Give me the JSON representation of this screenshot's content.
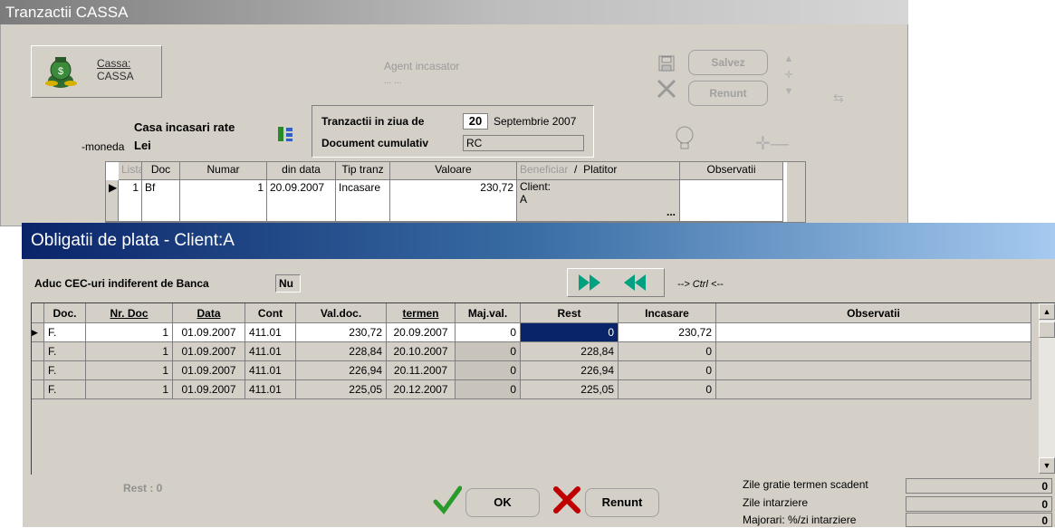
{
  "bg_window": {
    "title": "Tranzactii CASSA",
    "cassa_label": "Cassa:",
    "cassa_value": "CASSA",
    "agent_label": "Agent incasator",
    "agent_value": "... ...",
    "save_label": "Salvez",
    "cancel_label": "Renunt",
    "casa_label": "Casa incasari rate",
    "moneda_label": "-moneda",
    "moneda_value": "Lei",
    "tranzactii_label": "Tranzactii in ziua de",
    "day": "20",
    "month_year": "Septembrie 2007",
    "doc_label": "Document cumulativ",
    "doc_value": "RC",
    "columns": [
      "Lista",
      "Doc",
      "Numar",
      "din data",
      "Tip tranz",
      "Valoare",
      "Beneficiar",
      "/",
      "Platitor",
      "Observatii"
    ],
    "row": {
      "lista": "1",
      "doc": "Bf",
      "numar": "1",
      "din_data": "20.09.2007",
      "tip": "Incasare",
      "valoare": "230,72",
      "beneficiar_line1": "Client:",
      "beneficiar_line2": "A",
      "ellipsis": "..."
    }
  },
  "dialog": {
    "title": "Obligatii de plata - Client:A",
    "aduc_label": "Aduc CEC-uri indiferent de Banca",
    "aduc_value": "Nu",
    "ctrl_hint": "--> Ctrl <--",
    "columns": [
      "Doc.",
      "Nr. Doc",
      "Data",
      "Cont",
      "Val.doc.",
      "termen",
      "Maj.val.",
      "Rest",
      "Incasare",
      "Observatii"
    ],
    "rows": [
      {
        "doc": "F.",
        "nr": "1",
        "data": "01.09.2007",
        "cont": "411.01",
        "val": "230,72",
        "termen": "20.09.2007",
        "maj": "0",
        "rest": "0",
        "incasare": "230,72",
        "obs": ""
      },
      {
        "doc": "F.",
        "nr": "1",
        "data": "01.09.2007",
        "cont": "411.01",
        "val": "228,84",
        "termen": "20.10.2007",
        "maj": "0",
        "rest": "228,84",
        "incasare": "0",
        "obs": ""
      },
      {
        "doc": "F.",
        "nr": "1",
        "data": "01.09.2007",
        "cont": "411.01",
        "val": "226,94",
        "termen": "20.11.2007",
        "maj": "0",
        "rest": "226,94",
        "incasare": "0",
        "obs": ""
      },
      {
        "doc": "F.",
        "nr": "1",
        "data": "01.09.2007",
        "cont": "411.01",
        "val": "225,05",
        "termen": "20.12.2007",
        "maj": "0",
        "rest": "225,05",
        "incasare": "0",
        "obs": ""
      }
    ],
    "rest_label": "Rest : 0",
    "ok_label": "OK",
    "cancel_label": "Renunt",
    "zile_gratie_label": "Zile gratie termen scadent",
    "zile_gratie_value": "0",
    "zile_intarziere_label": "Zile intarziere",
    "zile_intarziere_value": "0",
    "majorari_label": "Majorari: %/zi intarziere",
    "majorari_value": "0"
  },
  "colors": {
    "dialog_title_start": "#0a246a",
    "dialog_title_end": "#a6caf0",
    "nav_arrow": "#00a080",
    "ok_check": "#2a9a2a",
    "cancel_x": "#c00000",
    "cancel_r": "#c00000"
  }
}
